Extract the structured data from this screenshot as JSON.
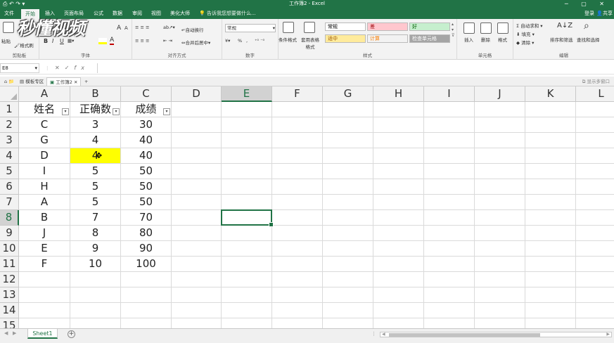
{
  "window": {
    "title": "工作簿2 - Excel",
    "quick_access": "⎙ ↶ ↷ ▾"
  },
  "menu": {
    "tabs": [
      "文件",
      "开始",
      "插入",
      "页面布局",
      "公式",
      "数据",
      "审阅",
      "视图",
      "美化大师"
    ],
    "active": "开始",
    "tell_me": "告诉我您想要做什么...",
    "login": "登录",
    "share": "共享"
  },
  "ribbon": {
    "clipboard": {
      "paste": "粘贴",
      "format_painter": "格式刷",
      "label": "剪贴板"
    },
    "font": {
      "bold": "B",
      "italic": "I",
      "underline": "U",
      "label": "字体",
      "size_up": "A",
      "size_down": "A"
    },
    "alignment": {
      "wrap": "自动换行",
      "merge": "合并后居中",
      "label": "对齐方式"
    },
    "number": {
      "format": "常规",
      "percent": "%",
      "comma": ",",
      "label": "数字"
    },
    "styles": {
      "conditional": "条件格式",
      "table": "套用表格格式",
      "label": "样式",
      "cells": [
        {
          "name": "常规",
          "bg": "#ffffff",
          "fg": "#000000"
        },
        {
          "name": "差",
          "bg": "#ffc7ce",
          "fg": "#9c0006"
        },
        {
          "name": "好",
          "bg": "#c6efce",
          "fg": "#006100"
        },
        {
          "name": "适中",
          "bg": "#ffeb9c",
          "fg": "#9c5700"
        },
        {
          "name": "计算",
          "bg": "#f2f2f2",
          "fg": "#fa7d00"
        },
        {
          "name": "检查单元格",
          "bg": "#a5a5a5",
          "fg": "#ffffff"
        }
      ]
    },
    "cells": {
      "insert": "插入",
      "delete": "删除",
      "format": "格式",
      "label": "单元格"
    },
    "editing": {
      "autosum": "自动求和",
      "fill": "填充",
      "clear": "清除",
      "sort": "排序和筛选",
      "find": "查找和选择",
      "label": "编辑"
    }
  },
  "watermark": "秒懂视频",
  "formula_bar": {
    "name_box": "E8",
    "cancel": "✕",
    "enter": "✓",
    "fx": "fx",
    "value": ""
  },
  "workbook_tabs": {
    "items": [
      "模板专区",
      "工作簿2"
    ],
    "active": "工作簿2",
    "more": "显示多窗口"
  },
  "sheet": {
    "columns": [
      "A",
      "B",
      "C",
      "D",
      "E",
      "F",
      "G",
      "H",
      "I",
      "J",
      "K",
      "L"
    ],
    "selected_column": "E",
    "rows": [
      "1",
      "2",
      "3",
      "4",
      "5",
      "6",
      "7",
      "8",
      "9",
      "10",
      "11",
      "12",
      "13",
      "14",
      "15"
    ],
    "selected_row": "8",
    "active_cell": "E8",
    "highlighted_cell": {
      "ref": "B4",
      "color": "#ffff00"
    },
    "data": [
      [
        "姓名",
        "正确数",
        "成绩"
      ],
      [
        "C",
        "3",
        "30"
      ],
      [
        "G",
        "4",
        "40"
      ],
      [
        "D",
        "4",
        "40"
      ],
      [
        "I",
        "5",
        "50"
      ],
      [
        "H",
        "5",
        "50"
      ],
      [
        "A",
        "5",
        "50"
      ],
      [
        "B",
        "7",
        "70"
      ],
      [
        "J",
        "8",
        "80"
      ],
      [
        "E",
        "9",
        "90"
      ],
      [
        "F",
        "10",
        "100"
      ]
    ],
    "filter_icon": "▾"
  },
  "sheet_tabs": {
    "items": [
      "Sheet1"
    ],
    "active": "Sheet1",
    "add": "+"
  },
  "colors": {
    "accent": "#217346",
    "highlight": "#ffff00"
  }
}
